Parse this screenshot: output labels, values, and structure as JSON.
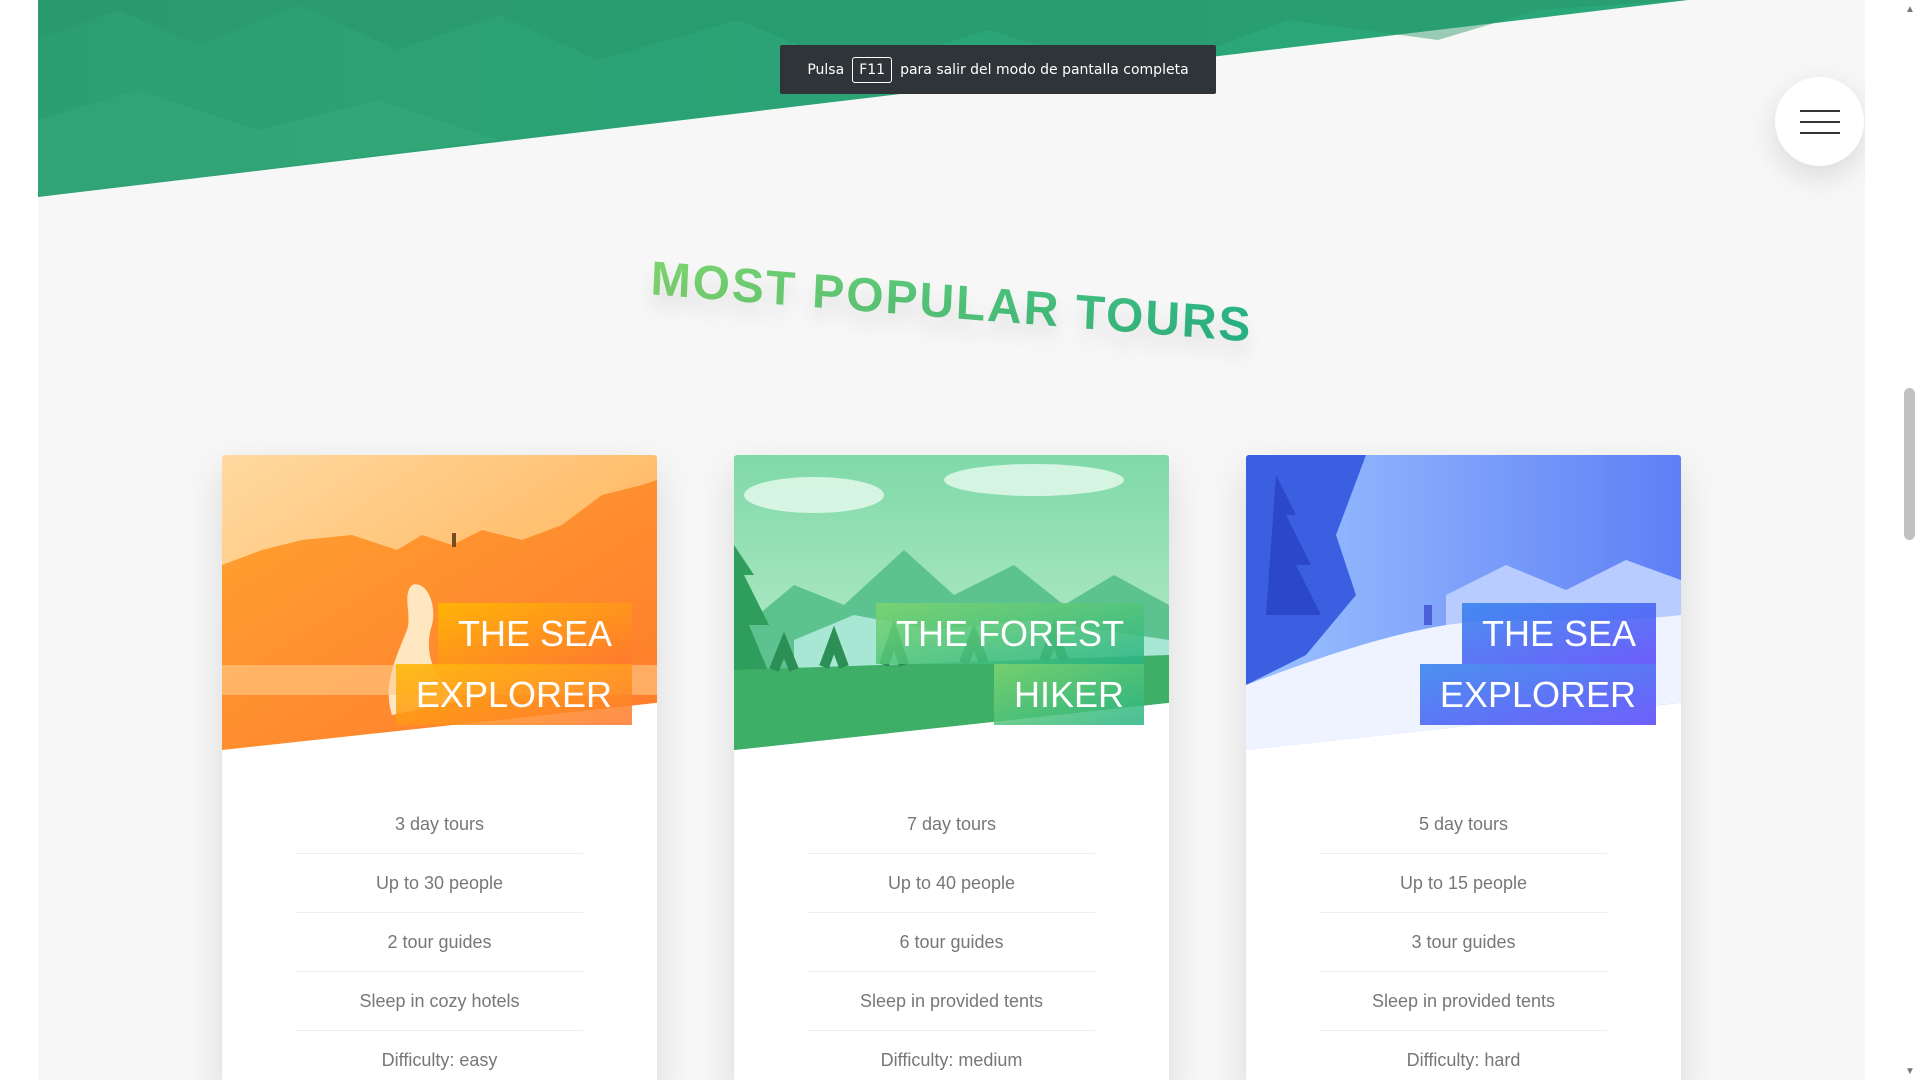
{
  "fullscreen_hint": {
    "prefix": "Pulsa",
    "key": "F11",
    "suffix": "para salir del modo de pantalla completa"
  },
  "nav": {
    "icon": "hamburger-menu-icon"
  },
  "section": {
    "title": "MOST POPULAR TOURS"
  },
  "colors": {
    "primary_light": "#7ed56f",
    "primary_dark": "#28b485",
    "orange_light": "#ffb900",
    "orange_dark": "#ff7730",
    "blue_light": "#2f80ed",
    "blue_dark": "#5643fa"
  },
  "cards": [
    {
      "heading_line1": "THE SEA",
      "heading_line2": "EXPLORER",
      "details": [
        "3 day tours",
        "Up to 30 people",
        "2 tour guides",
        "Sleep in cozy hotels",
        "Difficulty: easy"
      ]
    },
    {
      "heading_line1": "THE FOREST",
      "heading_line2": "HIKER",
      "details": [
        "7 day tours",
        "Up to 40 people",
        "6 tour guides",
        "Sleep in provided tents",
        "Difficulty: medium"
      ]
    },
    {
      "heading_line1": "THE SEA",
      "heading_line2": "EXPLORER",
      "details": [
        "5 day tours",
        "Up to 15 people",
        "3 tour guides",
        "Sleep in provided tents",
        "Difficulty: hard"
      ]
    }
  ]
}
